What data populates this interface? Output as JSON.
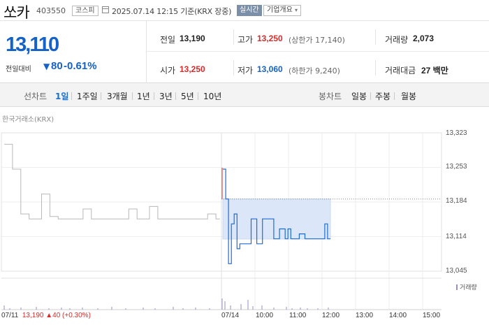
{
  "stock": {
    "name": "쏘카",
    "code": "403550",
    "market": "코스피",
    "timestamp": "2025.07.14 12:15 기준(KRX 장중)",
    "live_badge": "실시간",
    "company_info": "기업개요"
  },
  "quote": {
    "price": "13,110",
    "compare_label": "전일대비",
    "change_arrow": "▼",
    "change": "80",
    "change_rate": "-0.61%"
  },
  "stats": {
    "prev_label": "전일",
    "prev": "13,190",
    "high_label": "고가",
    "high": "13,250",
    "upper_limit": "(상한가 17,140)",
    "volume_label": "거래량",
    "volume": "2,073",
    "open_label": "시가",
    "open": "13,250",
    "low_label": "저가",
    "low": "13,060",
    "lower_limit": "(하한가 9,240)",
    "amount_label": "거래대금",
    "amount": "27 백만"
  },
  "tabs": {
    "period_label": "선차트",
    "period": [
      "1일",
      "1주일",
      "3개월",
      "1년",
      "3년",
      "5년",
      "10년"
    ],
    "active": "1일",
    "candle_label": "봉차트",
    "candle": [
      "일봉",
      "주봉",
      "월봉"
    ]
  },
  "chart": {
    "source": "한국거래소(KRX)",
    "volume_legend": "거래량",
    "footer_date": "07/11",
    "footer_price": "13,190",
    "footer_arrow": "▲",
    "footer_change": "40",
    "footer_rate": "(+0.30%)",
    "colors": {
      "today": "#1f6bd4",
      "prev_day": "#b8b8b8",
      "fill": "#dbe7f9",
      "volume": "#9a8cc8",
      "up": "#d62b2b"
    }
  },
  "chart_data": {
    "type": "line",
    "title": "",
    "ylim": [
      13045,
      13323
    ],
    "yticks": [
      "13,323",
      "13,253",
      "13,184",
      "13,114",
      "13,045"
    ],
    "xticks": [
      "07/14",
      "10:00",
      "11:00",
      "12:00",
      "13:00",
      "14:00",
      "15:00"
    ],
    "reference_line": 13190,
    "series": [
      {
        "name": "07/11",
        "values": [
          13300,
          13300,
          13250,
          13250,
          13160,
          13160,
          13150,
          13150,
          13150,
          13200,
          13200,
          13155,
          13155,
          13150,
          13150,
          13150,
          13150,
          13150,
          13150,
          13170,
          13170,
          13150,
          13150,
          13150,
          13150,
          13150,
          13150,
          13150,
          13150,
          13150,
          13170,
          13170,
          13150,
          13150,
          13150,
          13175,
          13175,
          13150,
          13150,
          13150,
          13150,
          13150,
          13150,
          13150,
          13150,
          13150,
          13150,
          13150,
          13150,
          13160,
          13160,
          13150,
          13150
        ]
      },
      {
        "name": "07/14",
        "values": [
          13250,
          13190,
          13060,
          13140,
          13160,
          13090,
          13100,
          13100,
          13100,
          13100,
          13150,
          13150,
          13100,
          13100,
          13150,
          13150,
          13150,
          13150,
          13110,
          13110,
          13130,
          13130,
          13110,
          13130,
          13110,
          13110,
          13110,
          13120,
          13120,
          13110,
          13110,
          13110,
          13110,
          13110,
          13110,
          13110,
          13140,
          13110,
          13110
        ]
      }
    ]
  }
}
